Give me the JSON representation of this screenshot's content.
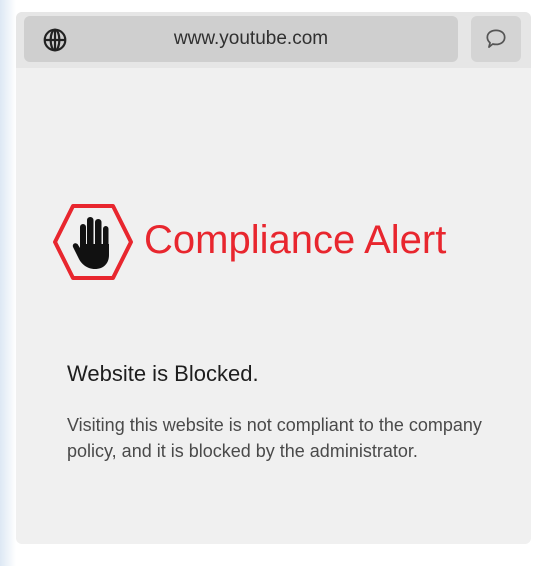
{
  "browser": {
    "url": "www.youtube.com",
    "address_icon": "globe-icon",
    "action_icon": "chat-bubble-icon"
  },
  "alert": {
    "icon": "stop-hand-icon",
    "title": "Compliance Alert",
    "accent_color": "#e8262e",
    "heading": "Website is Blocked.",
    "message": "Visiting this website is not compliant to the company policy, and it is blocked by the administrator."
  }
}
